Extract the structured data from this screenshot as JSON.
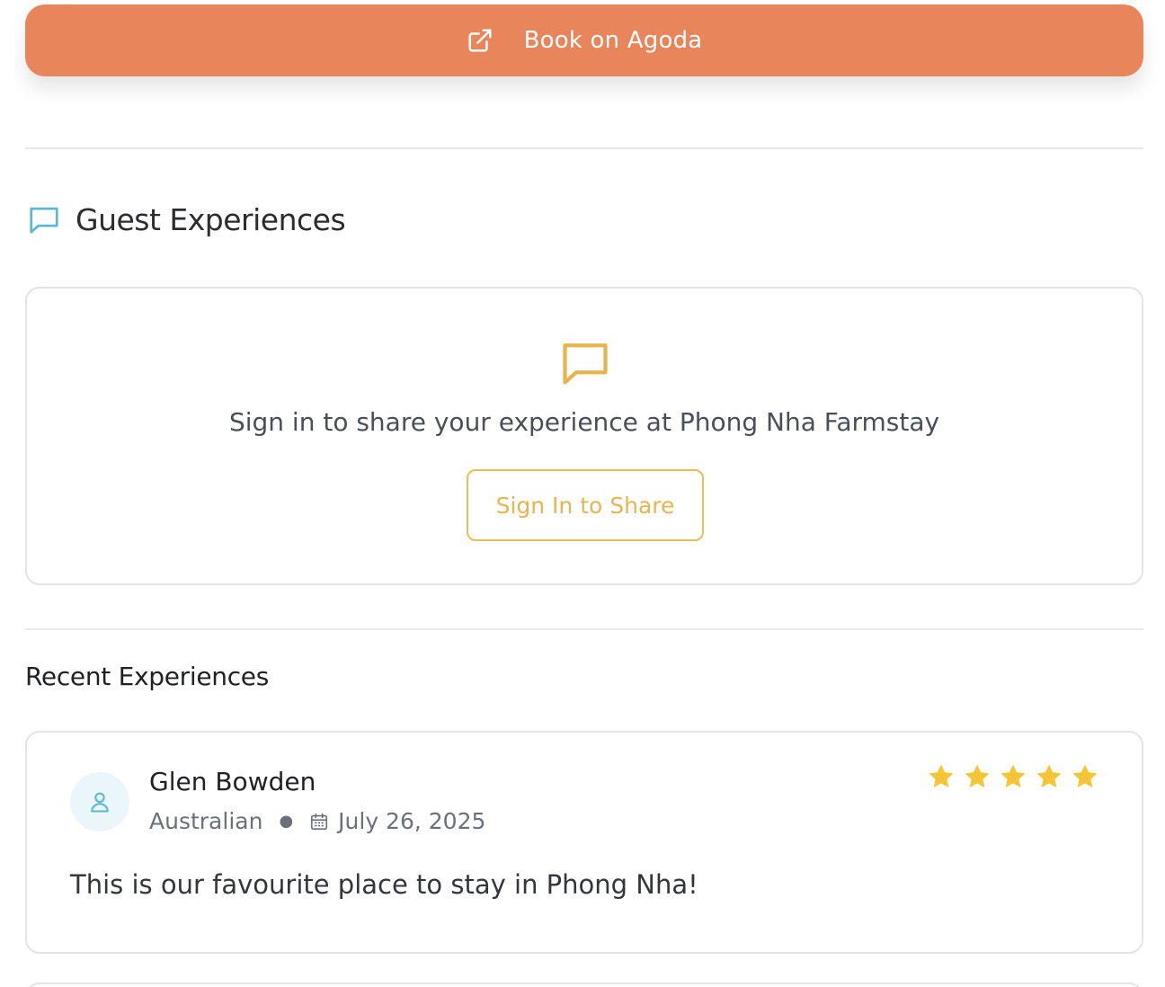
{
  "booking": {
    "label": "Book on Agoda",
    "icon": "external-link-icon",
    "color": "#e9855b"
  },
  "guest_section": {
    "title": "Guest Experiences",
    "icon": "chat-bubble-icon",
    "icon_color": "#5bb8cf"
  },
  "signin_card": {
    "icon": "chat-bubble-icon",
    "icon_color": "#e6b54f",
    "prompt": "Sign in to share your experience at Phong Nha Farmstay",
    "button_label": "Sign In to Share"
  },
  "recent": {
    "title": "Recent Experiences",
    "reviews": [
      {
        "name": "Glen Bowden",
        "nationality": "Australian",
        "date": "July 26, 2025",
        "rating": 5,
        "max_rating": 5,
        "text": "This is our favourite place to stay in Phong Nha!",
        "avatar_icon": "user-icon",
        "star_color": "#f4c535"
      }
    ]
  }
}
